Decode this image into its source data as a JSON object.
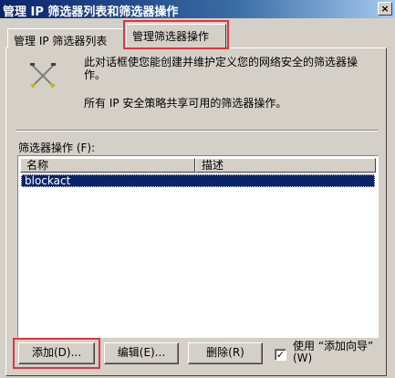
{
  "window": {
    "title": "管理 IP 筛选器列表和筛选器操作",
    "close_glyph": "×"
  },
  "tabs": [
    {
      "label": "管理 IP 筛选器列表"
    },
    {
      "label": "管理筛选器操作"
    }
  ],
  "info": {
    "line1": "此对话框使您能创建并维护定义您的网络安全的筛选器操作。",
    "line2": "所有 IP 安全策略共享可用的筛选器操作。"
  },
  "list": {
    "label": "筛选器操作 (F):",
    "columns": [
      "名称",
      "描述"
    ],
    "rows": [
      {
        "name": "blockact",
        "description": ""
      }
    ]
  },
  "buttons": {
    "add": "添加(D)...",
    "edit": "编辑(E)...",
    "remove": "删除(R)"
  },
  "wizard": {
    "checked": true,
    "check_glyph": "✓",
    "label": "使用 “添加向导” (W)"
  },
  "colors": {
    "highlight": "#e8323c",
    "selection": "#0a246a",
    "title_bar": "#0a246a"
  },
  "icons": [
    "tools-icon",
    "close-icon",
    "checkmark-icon"
  ]
}
